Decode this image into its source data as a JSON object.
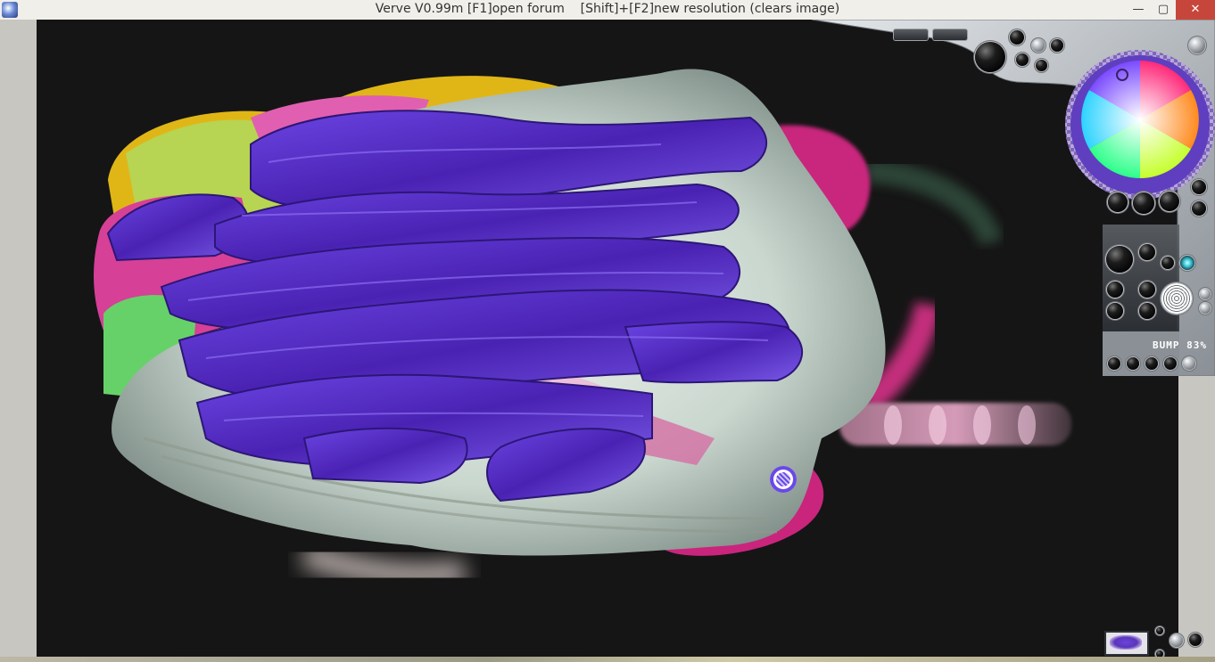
{
  "window": {
    "title": "Verve V0.99m [F1]open forum    [Shift]+[F2]new resolution (clears image)",
    "minimize_glyph": "—",
    "maximize_glyph": "▢",
    "close_glyph": "✕"
  },
  "panel": {
    "bump_label": "BUMP 83%",
    "bump_percent": 83
  },
  "colors": {
    "canvas_background": "#151515",
    "brush_purple": "#5a33c4",
    "panel_metal": "#c3c6ca",
    "close_button": "#c7463b"
  },
  "icons": [
    "app-icon",
    "minimize-icon",
    "maximize-icon",
    "close-icon",
    "color-wheel",
    "brush-cursor-icon"
  ]
}
